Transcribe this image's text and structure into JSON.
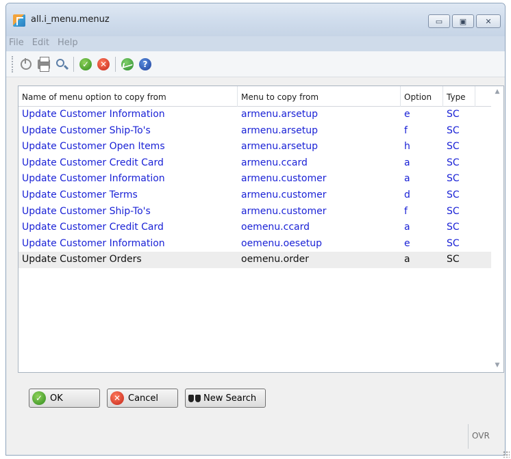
{
  "window": {
    "title": "all.i_menu.menuz",
    "controls": {
      "minimize": "▭",
      "maximize": "▣",
      "close": "✕"
    }
  },
  "menubar": {
    "items": [
      "File",
      "Edit",
      "Help"
    ]
  },
  "toolbar": {
    "icons": [
      "power-icon",
      "print-icon",
      "zoom-icon",
      "check-icon",
      "cancel-icon",
      "chart-icon",
      "help-icon"
    ]
  },
  "table": {
    "columns": [
      "Name of menu option to copy from",
      "Menu to copy from",
      "Option",
      "Type"
    ],
    "rows": [
      [
        "Update Customer Information",
        "armenu.arsetup",
        "e",
        "SC"
      ],
      [
        "Update Customer Ship-To's",
        "armenu.arsetup",
        "f",
        "SC"
      ],
      [
        "Update Customer Open Items",
        "armenu.arsetup",
        "h",
        "SC"
      ],
      [
        "Update Customer Credit Card",
        "armenu.ccard",
        "a",
        "SC"
      ],
      [
        "Update Customer Information",
        "armenu.customer",
        "a",
        "SC"
      ],
      [
        "Update Customer Terms",
        "armenu.customer",
        "d",
        "SC"
      ],
      [
        "Update Customer Ship-To's",
        "armenu.customer",
        "f",
        "SC"
      ],
      [
        "Update Customer Credit Card",
        "oemenu.ccard",
        "a",
        "SC"
      ],
      [
        "Update Customer Information",
        "oemenu.oesetup",
        "e",
        "SC"
      ],
      [
        "Update Customer Orders",
        "oemenu.order",
        "a",
        "SC"
      ]
    ],
    "selected_row_index": 9,
    "link_color": "#1a22d6"
  },
  "buttons": {
    "ok": "OK",
    "cancel": "Cancel",
    "new_search": "New Search"
  },
  "status": {
    "mode": "OVR"
  }
}
